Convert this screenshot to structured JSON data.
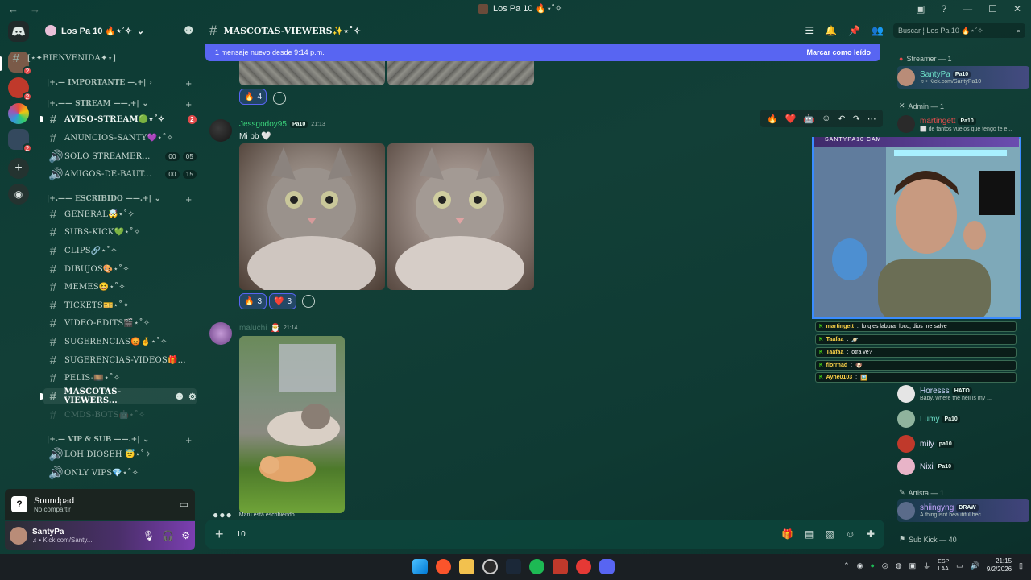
{
  "window": {
    "title": "Los Pa 10 🔥⋆˚✧"
  },
  "servers": {
    "badges": [
      "2",
      "2",
      "2"
    ]
  },
  "guild": {
    "name": "Los Pa 10 🔥⋆˚✧"
  },
  "channels": [
    {
      "name": "[⋆✦BIENVENIDA✦⋆]"
    },
    {
      "category": "|+.— IMPORTANTE —.+|"
    },
    {
      "category": "|+.—— STREAM ——.+|"
    },
    {
      "name": "AVISO-STREAM🟢⋆˚✧",
      "badge": "2"
    },
    {
      "name": "ANUNCIOS-SANTY💜⋆˚✧"
    },
    {
      "name": "SOLO STREAMER...",
      "nums": [
        "00",
        "05"
      ]
    },
    {
      "name": "AMIGOS-DE-BAUT...",
      "nums": [
        "00",
        "15"
      ]
    },
    {
      "category": "|+.—— ESCRIBIDO ——.+|"
    },
    {
      "name": "GENERAL🤯⋆˚✧"
    },
    {
      "name": "SUBS-KICK💚⋆˚✧"
    },
    {
      "name": "CLIPS🔗⋆˚✧"
    },
    {
      "name": "DIBUJOS🎨⋆˚✧"
    },
    {
      "name": "MEMES😆⋆˚✧"
    },
    {
      "name": "TICKETS🎫⋆˚✧"
    },
    {
      "name": "VIDEO-EDITS🎬⋆˚✧"
    },
    {
      "name": "SUGERENCIAS😡🤞⋆˚✧"
    },
    {
      "name": "SUGERENCIAS-VIDEOS🎁..."
    },
    {
      "name": "PELIS-🎞️⋆˚✧"
    },
    {
      "name": "MASCOTAS-VIEWERS..."
    },
    {
      "name": "CMDS-BOTS🤖⋆˚✧"
    },
    {
      "category": "|+.— VIP & SUB ——.+|"
    },
    {
      "name": "LOH DIOSEH 😇⋆˚✧"
    },
    {
      "name": "ONLY VIPS💎⋆˚✧"
    }
  ],
  "soundpad": {
    "title": "Soundpad",
    "subtitle": "No compartir"
  },
  "user": {
    "name": "SantyPa",
    "status": "♫ • Kick.com/Santy..."
  },
  "chat": {
    "channel": "MASCOTAS-VIEWERS✨⋆˚✧",
    "new_banner": "1 mensaje nuevo desde 9:14 p.m.",
    "mark_read": "Marcar como leído",
    "search_placeholder": "Buscar ¦ Los Pa 10 🔥⋆˚✧",
    "messages": [
      {
        "reactions": [
          {
            "emoji": "🔥",
            "count": "4"
          }
        ]
      },
      {
        "author": "Jessgodoy95",
        "tag": "Pa10",
        "time": "21:13",
        "text": "Mi bb 🤍",
        "reactions": [
          {
            "emoji": "🔥",
            "count": "3"
          },
          {
            "emoji": "❤️",
            "count": "3"
          }
        ]
      },
      {
        "author": "maluchi",
        "time": "21:14"
      }
    ],
    "typing": "Maru está escribiendo...",
    "composer_value": "10"
  },
  "members": {
    "groups": [
      {
        "label": "Streamer — 1"
      },
      {
        "label": "Admin — 1"
      },
      {
        "label": "Artista — 1"
      },
      {
        "label": "Sub Kick — 40"
      }
    ],
    "list": [
      {
        "name": "SantyPa",
        "tag": "Pa10",
        "status": "♫ • Kick.com/SantyPa10",
        "color": "#6ee0c9"
      },
      {
        "name": "martingett",
        "tag": "Pa10",
        "status": "⬜ de tantos vuelos que tengo te e...",
        "color": "#e24b4b"
      },
      {
        "name": "Horesss",
        "tag": "HATO",
        "status": "Baby, where the hell is my ...",
        "color": "#cfd8ff"
      },
      {
        "name": "Lumy",
        "tag": "Pa10",
        "status": "",
        "color": "#6ee0c9"
      },
      {
        "name": "mily",
        "tag": "pa10",
        "status": "",
        "color": "#e9e4ff"
      },
      {
        "name": "Nixi",
        "tag": "Pa10",
        "status": "",
        "color": "#e9e4ff"
      },
      {
        "name": "shiingyng",
        "tag": "DRAW",
        "status": "A thing isnt beautiful bec...",
        "color": "#c5a6ff"
      }
    ]
  },
  "stream_overlay": {
    "cam_title": "SANTYPA10 CAM",
    "chat": [
      {
        "user": "martingett",
        "text": "lo q es laburar loco, dios me salve"
      },
      {
        "user": "Taafaa",
        "text": "🪐"
      },
      {
        "user": "Taafaa",
        "text": "otra ve?"
      },
      {
        "user": "florrnad",
        "text": "🐶"
      },
      {
        "user": "Ayne0103",
        "text": "🖼️"
      }
    ]
  },
  "taskbar": {
    "lang1": "ESP",
    "lang2": "LAA",
    "time": "21:15",
    "date": "9/2/2026"
  }
}
